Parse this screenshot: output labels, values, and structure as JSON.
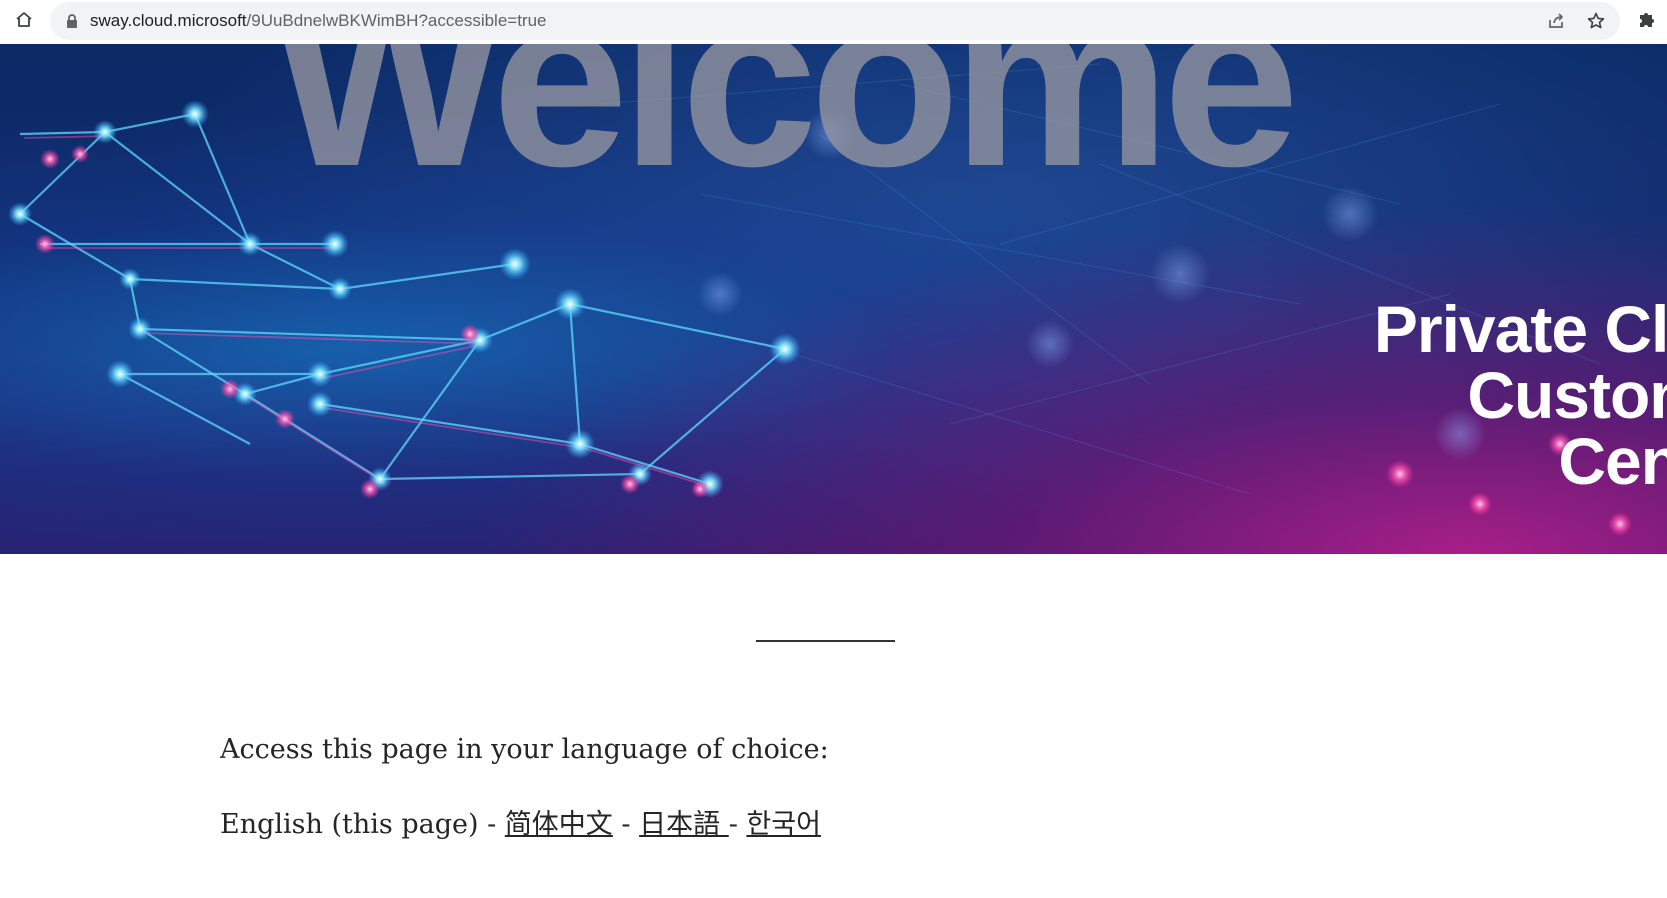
{
  "browser": {
    "url_host": "sway.cloud.microsoft",
    "url_path": "/9UuBdnelwBKWimBH?accessible=true",
    "icons": [
      "home-icon",
      "lock-icon",
      "share-icon",
      "star-icon",
      "puzzle-icon"
    ]
  },
  "banner": {
    "welcome_text": "Welcome",
    "brand_lines": [
      "Private Clou",
      "Custom",
      "Cent"
    ],
    "colors": {
      "deep_blue": "#0b2a66",
      "magenta": "#be1e8c",
      "cyan": "#3fd0ff",
      "welcome_gray": "#96969f"
    }
  },
  "content": {
    "prompt": "Access this page in your language of choice:",
    "current_language": "English (this page)",
    "separator": " - ",
    "languages": [
      {
        "label": "简体中文"
      },
      {
        "label": "日本語 "
      },
      {
        "label": "한국어"
      }
    ]
  }
}
